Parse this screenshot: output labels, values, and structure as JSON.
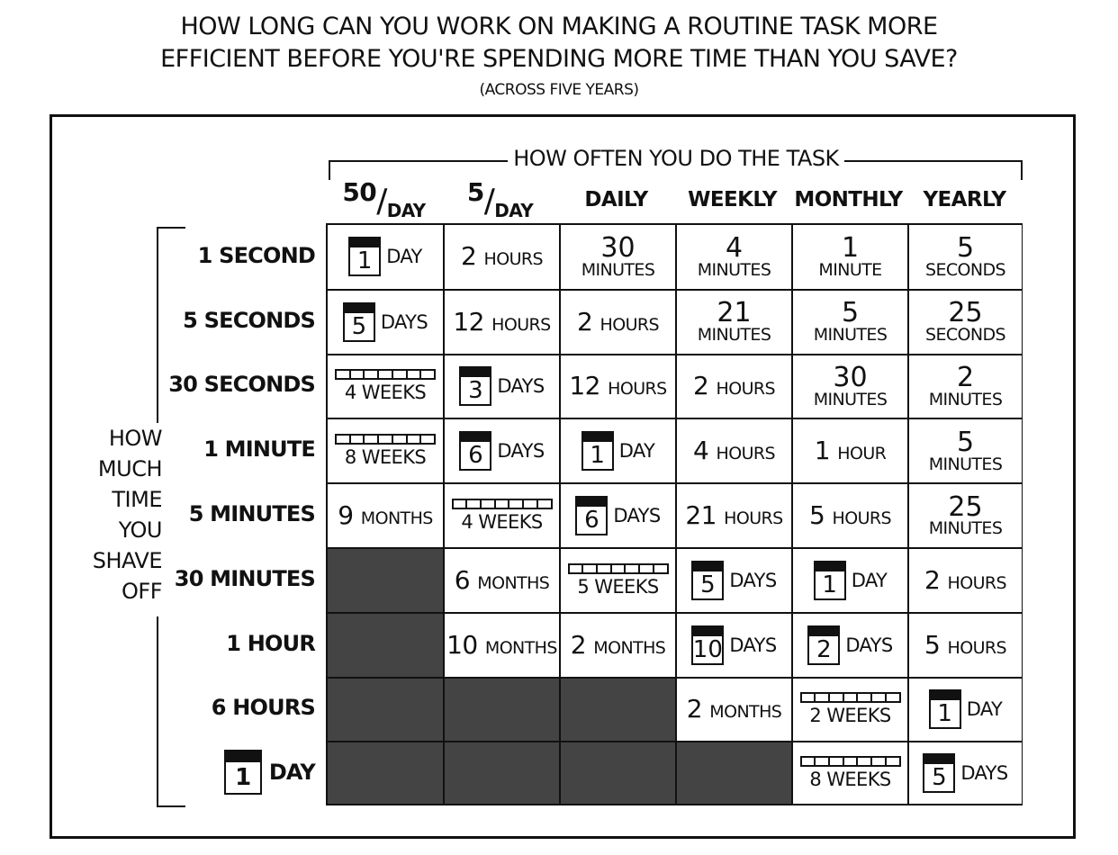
{
  "title": {
    "line1": "HOW LONG CAN YOU WORK ON MAKING A ROUTINE TASK MORE",
    "line2": "EFFICIENT BEFORE YOU'RE SPENDING MORE TIME THAN YOU SAVE?",
    "line3": "(ACROSS FIVE YEARS)"
  },
  "colors": {
    "ink": "#111111",
    "empty_cell": "#444444",
    "background": "#ffffff"
  },
  "chart_data": {
    "type": "table",
    "title": "How long can you work on making a routine task more efficient before you're spending more time than you save? (across five years)",
    "column_axis_label": "HOW OFTEN YOU DO THE TASK",
    "row_axis_label": [
      "HOW",
      "MUCH",
      "TIME",
      "YOU",
      "SHAVE",
      "OFF"
    ],
    "columns": [
      {
        "label": "50/DAY",
        "num": "50",
        "den": "DAY"
      },
      {
        "label": "5/DAY",
        "num": "5",
        "den": "DAY"
      },
      {
        "label": "DAILY"
      },
      {
        "label": "WEEKLY"
      },
      {
        "label": "MONTHLY"
      },
      {
        "label": "YEARLY"
      }
    ],
    "rows": [
      {
        "label": "1 SECOND",
        "cells": [
          {
            "kind": "cal",
            "num": "1",
            "unit": "DAY"
          },
          {
            "kind": "inline",
            "num": "2",
            "unit": "HOURS"
          },
          {
            "kind": "stack",
            "num": "30",
            "unit": "MINUTES"
          },
          {
            "kind": "stack",
            "num": "4",
            "unit": "MINUTES"
          },
          {
            "kind": "stack",
            "num": "1",
            "unit": "MINUTE"
          },
          {
            "kind": "stack",
            "num": "5",
            "unit": "SECONDS"
          }
        ]
      },
      {
        "label": "5 SECONDS",
        "cells": [
          {
            "kind": "cal",
            "num": "5",
            "unit": "DAYS"
          },
          {
            "kind": "inline",
            "num": "12",
            "unit": "HOURS"
          },
          {
            "kind": "inline",
            "num": "2",
            "unit": "HOURS"
          },
          {
            "kind": "stack",
            "num": "21",
            "unit": "MINUTES"
          },
          {
            "kind": "stack",
            "num": "5",
            "unit": "MINUTES"
          },
          {
            "kind": "stack",
            "num": "25",
            "unit": "SECONDS"
          }
        ]
      },
      {
        "label": "30 SECONDS",
        "cells": [
          {
            "kind": "weeks",
            "num": "4",
            "unit": "WEEKS"
          },
          {
            "kind": "cal",
            "num": "3",
            "unit": "DAYS"
          },
          {
            "kind": "inline",
            "num": "12",
            "unit": "HOURS"
          },
          {
            "kind": "inline",
            "num": "2",
            "unit": "HOURS"
          },
          {
            "kind": "stack",
            "num": "30",
            "unit": "MINUTES"
          },
          {
            "kind": "stack",
            "num": "2",
            "unit": "MINUTES"
          }
        ]
      },
      {
        "label": "1 MINUTE",
        "cells": [
          {
            "kind": "weeks",
            "num": "8",
            "unit": "WEEKS"
          },
          {
            "kind": "cal",
            "num": "6",
            "unit": "DAYS"
          },
          {
            "kind": "cal",
            "num": "1",
            "unit": "DAY"
          },
          {
            "kind": "inline",
            "num": "4",
            "unit": "HOURS"
          },
          {
            "kind": "inline",
            "num": "1",
            "unit": "HOUR"
          },
          {
            "kind": "stack",
            "num": "5",
            "unit": "MINUTES"
          }
        ]
      },
      {
        "label": "5 MINUTES",
        "cells": [
          {
            "kind": "inline",
            "num": "9",
            "unit": "MONTHS"
          },
          {
            "kind": "weeks",
            "num": "4",
            "unit": "WEEKS"
          },
          {
            "kind": "cal",
            "num": "6",
            "unit": "DAYS"
          },
          {
            "kind": "inline",
            "num": "21",
            "unit": "HOURS"
          },
          {
            "kind": "inline",
            "num": "5",
            "unit": "HOURS"
          },
          {
            "kind": "stack",
            "num": "25",
            "unit": "MINUTES"
          }
        ]
      },
      {
        "label": "30 MINUTES",
        "cells": [
          {
            "kind": "empty"
          },
          {
            "kind": "inline",
            "num": "6",
            "unit": "MONTHS"
          },
          {
            "kind": "weeks",
            "num": "5",
            "unit": "WEEKS"
          },
          {
            "kind": "cal",
            "num": "5",
            "unit": "DAYS"
          },
          {
            "kind": "cal",
            "num": "1",
            "unit": "DAY"
          },
          {
            "kind": "inline",
            "num": "2",
            "unit": "HOURS"
          }
        ]
      },
      {
        "label": "1 HOUR",
        "cells": [
          {
            "kind": "empty"
          },
          {
            "kind": "inline",
            "num": "10",
            "unit": "MONTHS"
          },
          {
            "kind": "inline",
            "num": "2",
            "unit": "MONTHS"
          },
          {
            "kind": "cal",
            "num": "10",
            "unit": "DAYS"
          },
          {
            "kind": "cal",
            "num": "2",
            "unit": "DAYS"
          },
          {
            "kind": "inline",
            "num": "5",
            "unit": "HOURS"
          }
        ]
      },
      {
        "label": "6 HOURS",
        "cells": [
          {
            "kind": "empty"
          },
          {
            "kind": "empty"
          },
          {
            "kind": "empty"
          },
          {
            "kind": "inline",
            "num": "2",
            "unit": "MONTHS"
          },
          {
            "kind": "weeks",
            "num": "2",
            "unit": "WEEKS"
          },
          {
            "kind": "cal",
            "num": "1",
            "unit": "DAY"
          }
        ]
      },
      {
        "label": "1 DAY",
        "label_kind": "cal",
        "label_num": "1",
        "label_unit": "DAY",
        "cells": [
          {
            "kind": "empty"
          },
          {
            "kind": "empty"
          },
          {
            "kind": "empty"
          },
          {
            "kind": "empty"
          },
          {
            "kind": "weeks",
            "num": "8",
            "unit": "WEEKS"
          },
          {
            "kind": "cal",
            "num": "5",
            "unit": "DAYS"
          }
        ]
      }
    ]
  }
}
